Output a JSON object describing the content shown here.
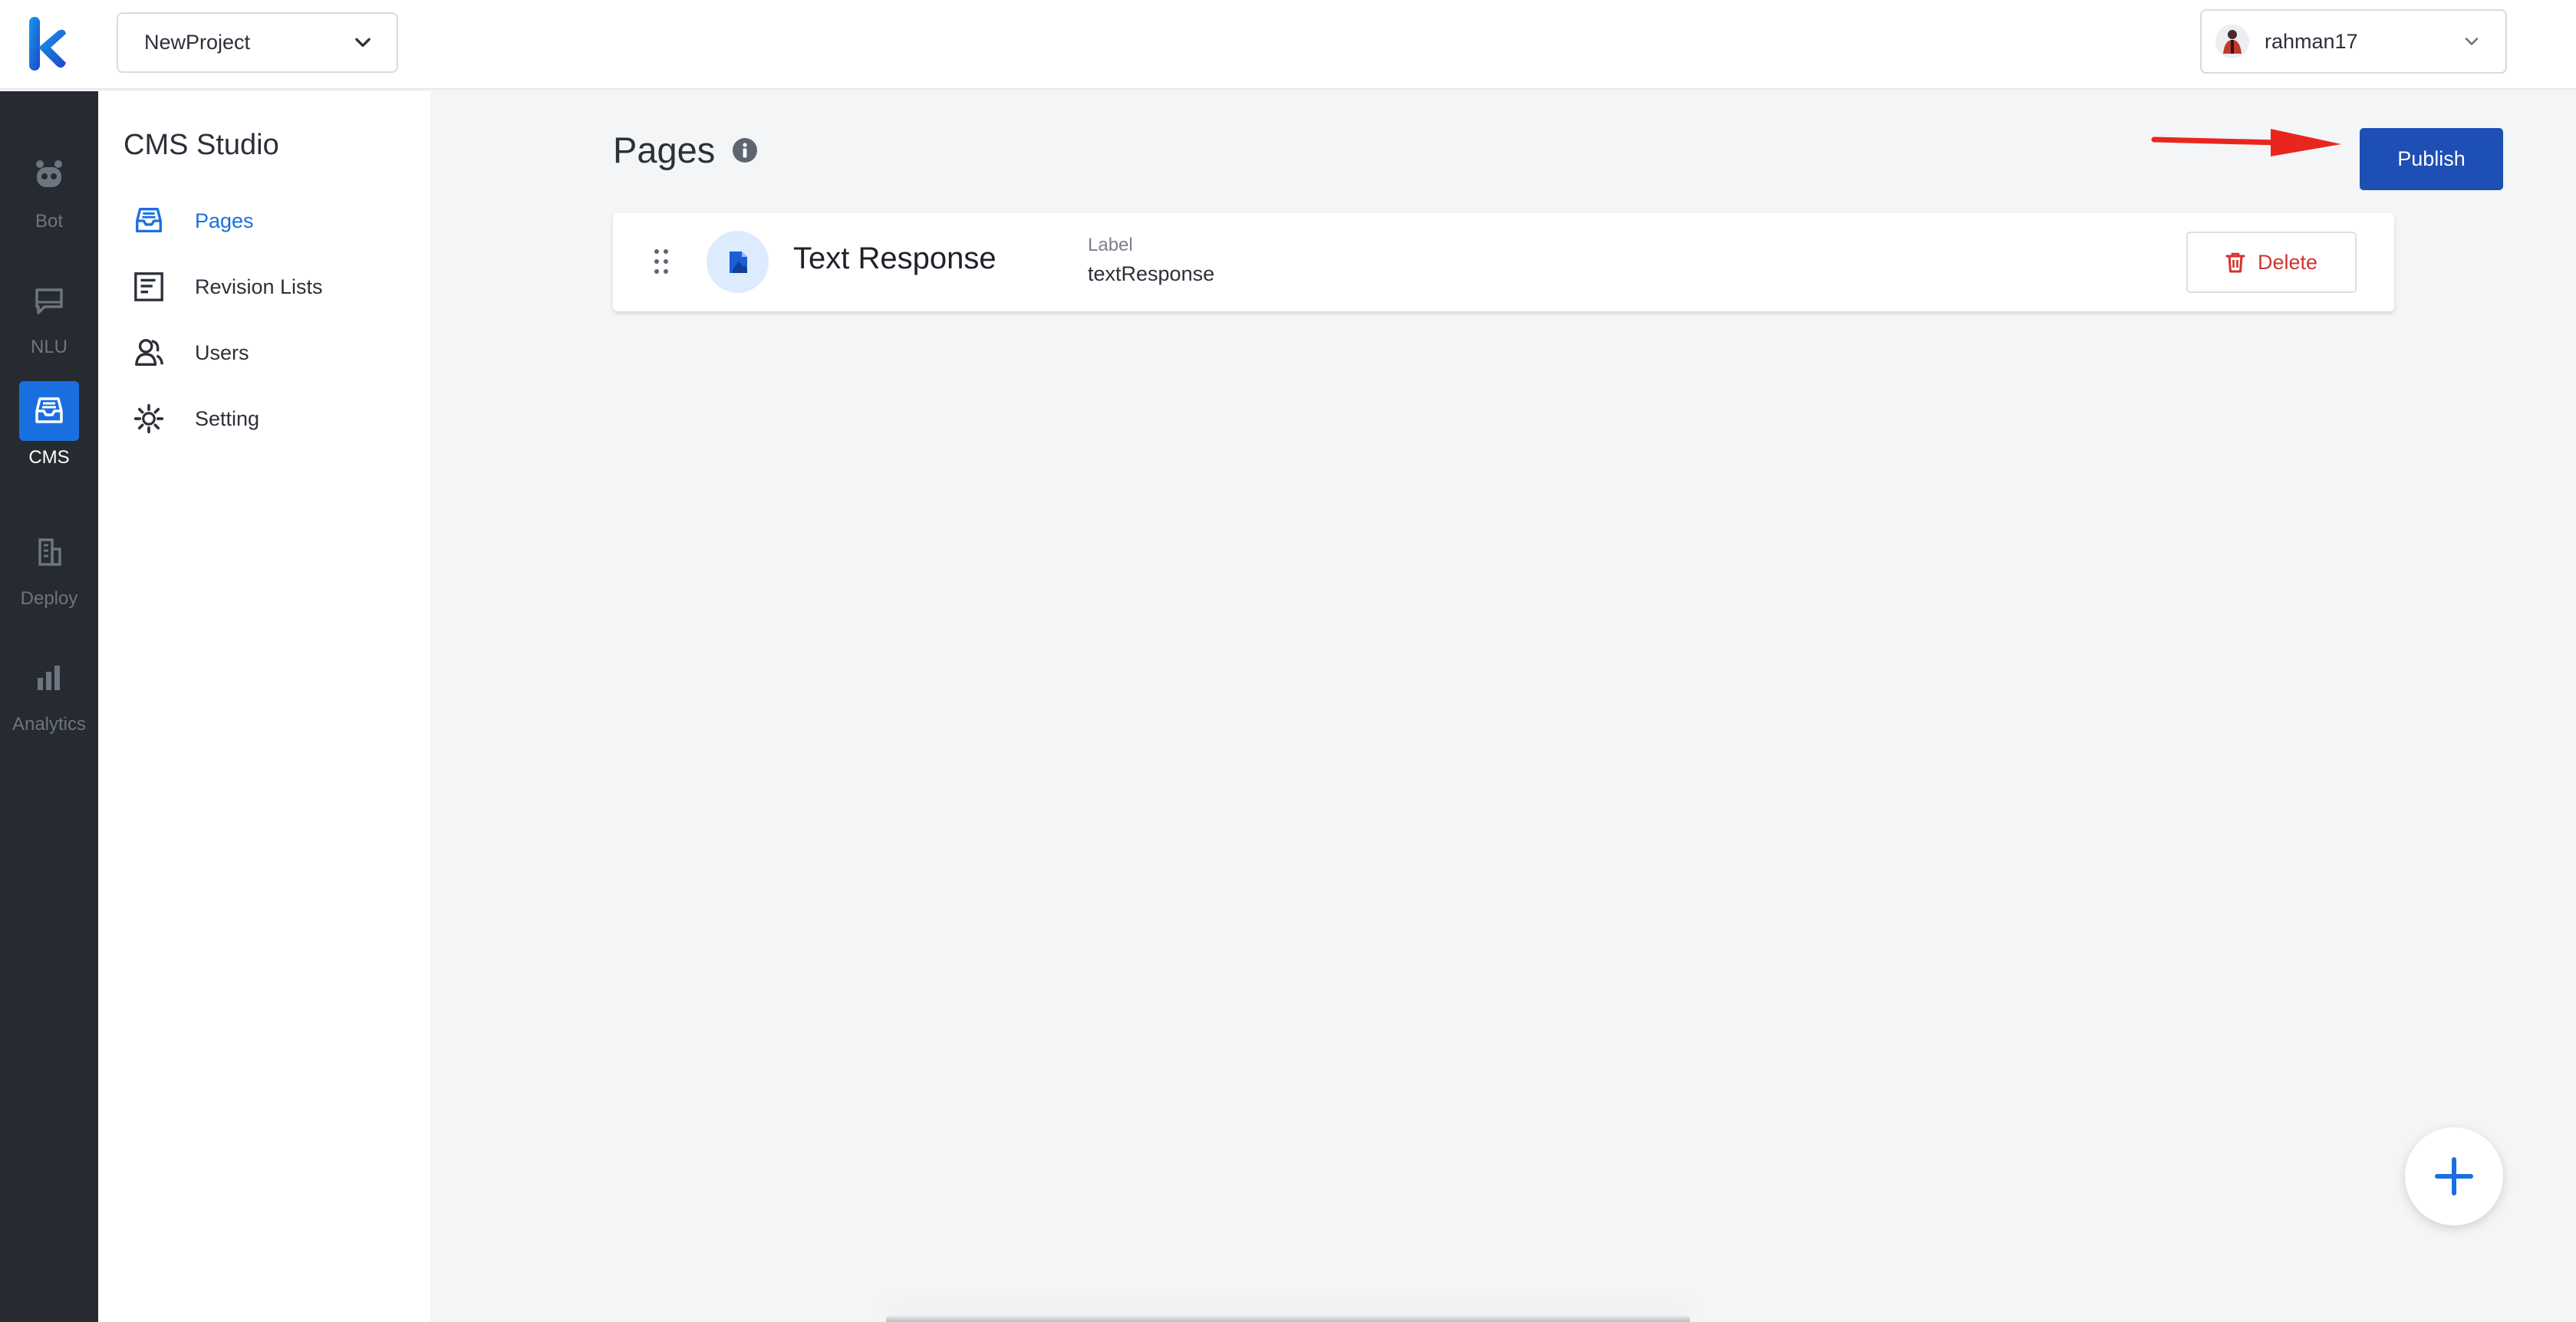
{
  "header": {
    "project": "NewProject",
    "user": "rahman17"
  },
  "rail": {
    "items": [
      {
        "label": "Bot",
        "icon": "bot-icon"
      },
      {
        "label": "NLU",
        "icon": "chat-icon"
      },
      {
        "label": "CMS",
        "icon": "inbox-icon",
        "active": true
      },
      {
        "label": "Deploy",
        "icon": "building-icon"
      },
      {
        "label": "Analytics",
        "icon": "bar-chart-icon"
      }
    ]
  },
  "sidebar": {
    "title": "CMS Studio",
    "items": [
      {
        "label": "Pages",
        "icon": "inbox-icon",
        "active": true
      },
      {
        "label": "Revision Lists",
        "icon": "list-box-icon"
      },
      {
        "label": "Users",
        "icon": "users-icon"
      },
      {
        "label": "Setting",
        "icon": "gear-icon"
      }
    ]
  },
  "main": {
    "title": "Pages",
    "publish_label": "Publish",
    "pages": [
      {
        "name": "Text Response",
        "label_caption": "Label",
        "label_value": "textResponse",
        "delete_label": "Delete"
      }
    ]
  },
  "colors": {
    "accent": "#1a6fe0",
    "publish": "#1e4fb5",
    "rail_bg": "#262a31",
    "danger": "#d6322c",
    "annotation_arrow": "#e8261e"
  }
}
